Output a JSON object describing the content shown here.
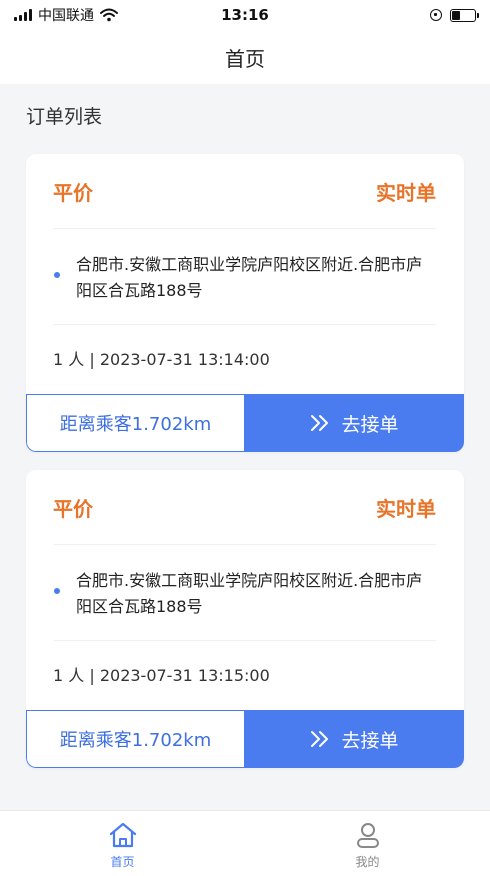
{
  "status_bar": {
    "carrier": "中国联通",
    "time": "13:16"
  },
  "nav": {
    "title": "首页"
  },
  "section": {
    "title": "订单列表"
  },
  "orders": [
    {
      "price_type": "平价",
      "order_type": "实时单",
      "address": "合肥市.安徽工商职业学院庐阳校区附近.合肥市庐阳区合瓦路188号",
      "meta": "1 人 | 2023-07-31 13:14:00",
      "distance": "距离乘客1.702km",
      "accept_label": "去接单"
    },
    {
      "price_type": "平价",
      "order_type": "实时单",
      "address": "合肥市.安徽工商职业学院庐阳校区附近.合肥市庐阳区合瓦路188号",
      "meta": "1 人 | 2023-07-31 13:15:00",
      "distance": "距离乘客1.702km",
      "accept_label": "去接单"
    }
  ],
  "tabs": [
    {
      "label": "首页",
      "icon": "home-icon",
      "active": true
    },
    {
      "label": "我的",
      "icon": "user-icon",
      "active": false
    }
  ],
  "colors": {
    "accent": "#4a7cf0",
    "orange": "#e8742a"
  }
}
